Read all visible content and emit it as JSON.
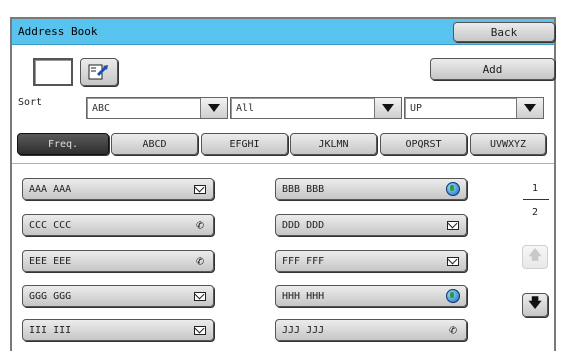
{
  "window": {
    "title": "Address Book"
  },
  "header": {
    "back_label": "Back",
    "add_label": "Add"
  },
  "sort": {
    "label": "Sort",
    "dropdowns": [
      {
        "value": "ABC"
      },
      {
        "value": "All"
      },
      {
        "value": "UP"
      }
    ]
  },
  "tabs": [
    {
      "label": "Freq.",
      "active": true
    },
    {
      "label": "ABCD",
      "active": false
    },
    {
      "label": "EFGHI",
      "active": false
    },
    {
      "label": "JKLMN",
      "active": false
    },
    {
      "label": "OPQRST",
      "active": false
    },
    {
      "label": "UVWXYZ",
      "active": false
    }
  ],
  "entries": [
    {
      "name": "AAA AAA",
      "icon": "email-icon"
    },
    {
      "name": "BBB BBB",
      "icon": "globe-icon"
    },
    {
      "name": "CCC CCC",
      "icon": "phone-icon"
    },
    {
      "name": "DDD DDD",
      "icon": "email-icon"
    },
    {
      "name": "EEE EEE",
      "icon": "phone-icon"
    },
    {
      "name": "FFF FFF",
      "icon": "email-icon"
    },
    {
      "name": "GGG GGG",
      "icon": "email-icon"
    },
    {
      "name": "HHH HHH",
      "icon": "globe-icon"
    },
    {
      "name": "III III",
      "icon": "email-icon"
    },
    {
      "name": "JJJ JJJ",
      "icon": "phone-icon"
    }
  ],
  "pagination": {
    "current": "1",
    "total": "2"
  }
}
